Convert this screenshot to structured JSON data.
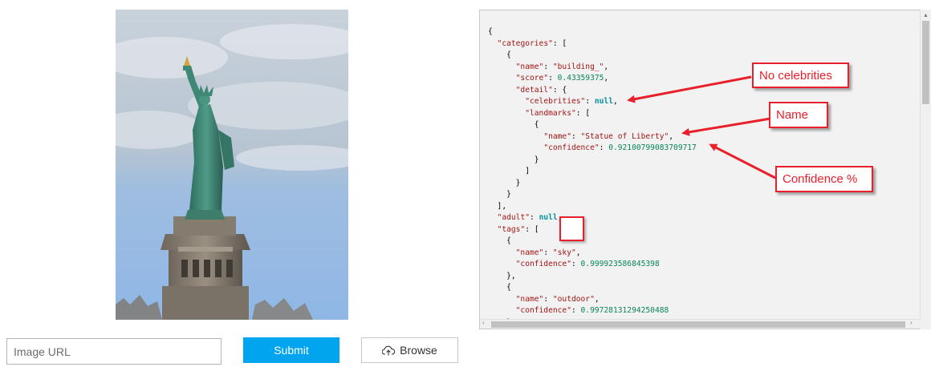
{
  "form": {
    "url_placeholder": "Image URL",
    "submit_label": "Submit",
    "browse_label": "Browse"
  },
  "json_lines": [
    [
      [
        "p",
        "{"
      ]
    ],
    [
      [
        "p",
        "  "
      ],
      [
        "k",
        "\"categories\""
      ],
      [
        "p",
        ": ["
      ]
    ],
    [
      [
        "p",
        "    {"
      ]
    ],
    [
      [
        "p",
        "      "
      ],
      [
        "k",
        "\"name\""
      ],
      [
        "p",
        ": "
      ],
      [
        "s",
        "\"building_\""
      ],
      [
        "p",
        ","
      ]
    ],
    [
      [
        "p",
        "      "
      ],
      [
        "k",
        "\"score\""
      ],
      [
        "p",
        ": "
      ],
      [
        "n",
        "0.43359375"
      ],
      [
        "p",
        ","
      ]
    ],
    [
      [
        "p",
        "      "
      ],
      [
        "k",
        "\"detail\""
      ],
      [
        "p",
        ": {"
      ]
    ],
    [
      [
        "p",
        "        "
      ],
      [
        "k",
        "\"celebrities\""
      ],
      [
        "p",
        ": "
      ],
      [
        "kw",
        "null"
      ],
      [
        "p",
        ","
      ]
    ],
    [
      [
        "p",
        "        "
      ],
      [
        "k",
        "\"landmarks\""
      ],
      [
        "p",
        ": ["
      ]
    ],
    [
      [
        "p",
        "          {"
      ]
    ],
    [
      [
        "p",
        "            "
      ],
      [
        "k",
        "\"name\""
      ],
      [
        "p",
        ": "
      ],
      [
        "s",
        "\"Statue of Liberty\""
      ],
      [
        "p",
        ","
      ]
    ],
    [
      [
        "p",
        "            "
      ],
      [
        "k",
        "\"confidence\""
      ],
      [
        "p",
        ": "
      ],
      [
        "n",
        "0.92100799083709717"
      ]
    ],
    [
      [
        "p",
        "          }"
      ]
    ],
    [
      [
        "p",
        "        ]"
      ]
    ],
    [
      [
        "p",
        "      }"
      ]
    ],
    [
      [
        "p",
        "    }"
      ]
    ],
    [
      [
        "p",
        "  ],"
      ]
    ],
    [
      [
        "p",
        "  "
      ],
      [
        "k",
        "\"adult\""
      ],
      [
        "p",
        ": "
      ],
      [
        "kw",
        "null"
      ],
      [
        "p",
        ","
      ]
    ],
    [
      [
        "p",
        "  "
      ],
      [
        "k",
        "\"tags\""
      ],
      [
        "p",
        ": ["
      ]
    ],
    [
      [
        "p",
        "    {"
      ]
    ],
    [
      [
        "p",
        "      "
      ],
      [
        "k",
        "\"name\""
      ],
      [
        "p",
        ": "
      ],
      [
        "s",
        "\"sky\""
      ],
      [
        "p",
        ","
      ]
    ],
    [
      [
        "p",
        "      "
      ],
      [
        "k",
        "\"confidence\""
      ],
      [
        "p",
        ": "
      ],
      [
        "n",
        "0.999923586845398"
      ]
    ],
    [
      [
        "p",
        "    },"
      ]
    ],
    [
      [
        "p",
        "    {"
      ]
    ],
    [
      [
        "p",
        "      "
      ],
      [
        "k",
        "\"name\""
      ],
      [
        "p",
        ": "
      ],
      [
        "s",
        "\"outdoor\""
      ],
      [
        "p",
        ","
      ]
    ],
    [
      [
        "p",
        "      "
      ],
      [
        "k",
        "\"confidence\""
      ],
      [
        "p",
        ": "
      ],
      [
        "n",
        "0.99728131294250488"
      ]
    ],
    [
      [
        "p",
        "    },"
      ]
    ]
  ],
  "annotations": {
    "celebrities": "No celebrities",
    "name": "Name",
    "confidence": "Confidence %"
  },
  "colors": {
    "accent_button": "#00a4ef",
    "callout_red": "#e8202a",
    "json_string": "#a31515",
    "json_number": "#09865a",
    "json_keyword": "#0a8f9a"
  },
  "icons": {
    "browse": "cloud-upload-icon"
  }
}
